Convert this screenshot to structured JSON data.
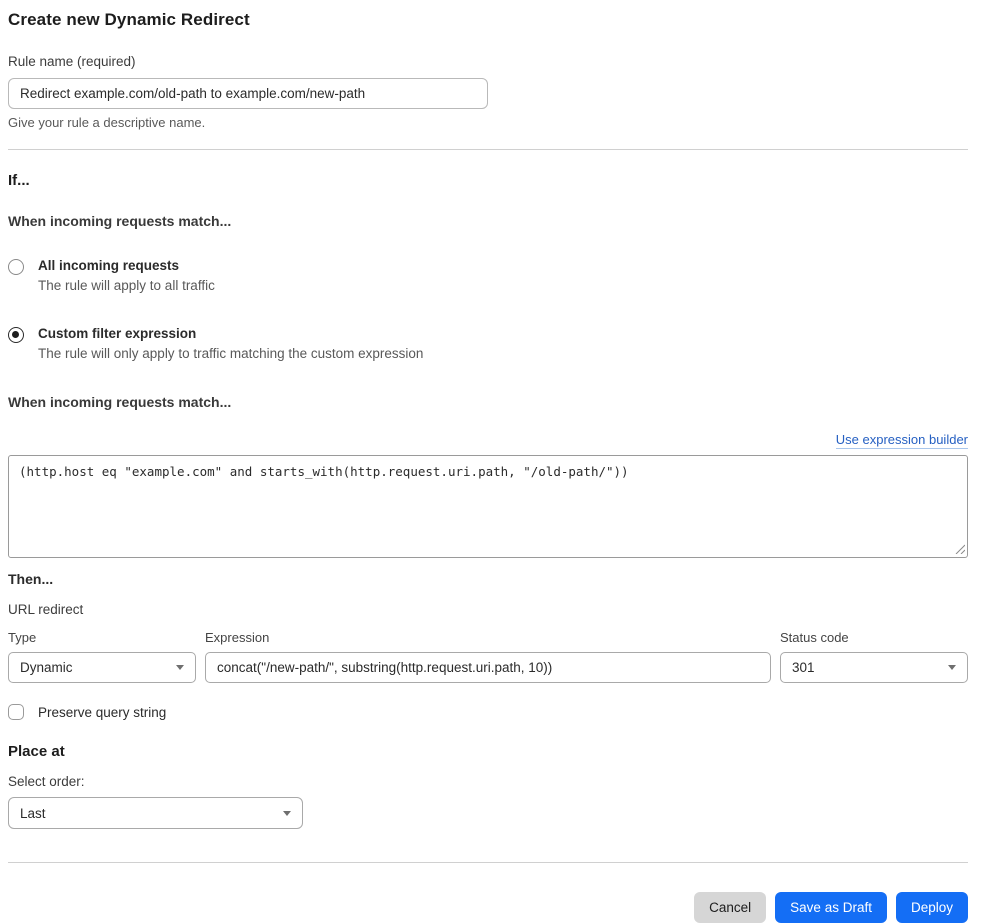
{
  "page": {
    "title": "Create new Dynamic Redirect"
  },
  "rule_name": {
    "label": "Rule name (required)",
    "value": "Redirect example.com/old-path to example.com/new-path",
    "helper": "Give your rule a descriptive name."
  },
  "if_section": {
    "heading": "If...",
    "match_heading": "When incoming requests match...",
    "options": [
      {
        "label": "All incoming requests",
        "description": "The rule will apply to all traffic",
        "selected": false
      },
      {
        "label": "Custom filter expression",
        "description": "The rule will only apply to traffic matching the custom expression",
        "selected": true
      }
    ]
  },
  "expression_editor": {
    "heading": "When incoming requests match...",
    "builder_link": "Use expression builder",
    "value": "(http.host eq \"example.com\" and starts_with(http.request.uri.path, \"/old-path/\"))"
  },
  "then_section": {
    "heading": "Then...",
    "subheading": "URL redirect",
    "type": {
      "label": "Type",
      "value": "Dynamic"
    },
    "expression": {
      "label": "Expression",
      "value": "concat(\"/new-path/\", substring(http.request.uri.path, 10))"
    },
    "status_code": {
      "label": "Status code",
      "value": "301"
    },
    "preserve_query": {
      "label": "Preserve query string",
      "checked": false
    }
  },
  "place_at": {
    "heading": "Place at",
    "label": "Select order:",
    "value": "Last"
  },
  "footer": {
    "cancel_label": "Cancel",
    "save_draft_label": "Save as Draft",
    "deploy_label": "Deploy"
  },
  "colors": {
    "primary_blue": "#146ef5",
    "link_blue": "#2660c2",
    "cancel_gray": "#d6d6d6"
  }
}
